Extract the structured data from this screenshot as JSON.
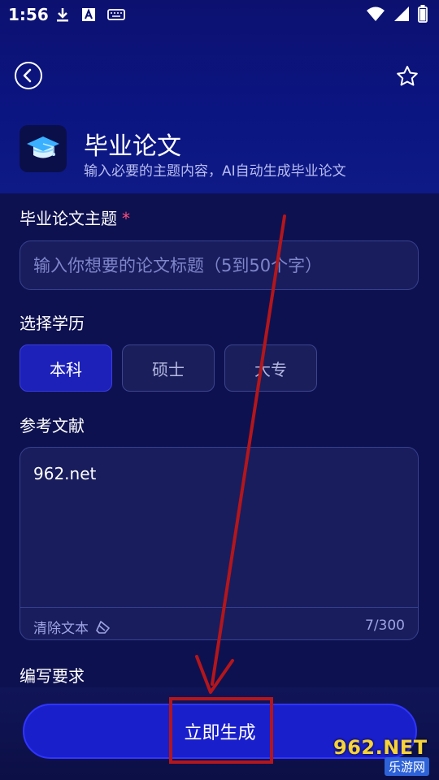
{
  "status_bar": {
    "time": "1:56",
    "left_icons": [
      "download-icon",
      "a-icon",
      "keyboard-icon"
    ],
    "right_icons": [
      "wifi-icon",
      "signal-icon",
      "battery-icon"
    ]
  },
  "nav": {
    "back_icon": "chevron-left-icon",
    "favorite_icon": "star-icon"
  },
  "app": {
    "icon": "graduation-cap-icon",
    "title": "毕业论文",
    "subtitle": "输入必要的主题内容，AI自动生成毕业论文"
  },
  "topic": {
    "label": "毕业论文主题",
    "required_mark": "*",
    "placeholder": "输入你想要的论文标题（5到50个字）",
    "value": ""
  },
  "degree": {
    "label": "选择学历",
    "options": [
      {
        "label": "本科",
        "selected": true
      },
      {
        "label": "硕士",
        "selected": false
      },
      {
        "label": "大专",
        "selected": false
      }
    ]
  },
  "references": {
    "label": "参考文献",
    "value": "962.net",
    "clear_label": "清除文本",
    "clear_icon": "eraser-icon",
    "counter": "7/300"
  },
  "requirements": {
    "label": "编写要求"
  },
  "generate_button": {
    "label": "立即生成"
  },
  "annotation": {
    "arrow_color": "#b3161b",
    "highlight_color": "#b3161b"
  },
  "watermark": {
    "brand": "962.NET",
    "site_text": "乐游网"
  },
  "colors": {
    "background": "#0e1150",
    "accent": "#1d21b9",
    "primary_button": "#1a1fcc",
    "required_star": "#ff4f7b"
  }
}
